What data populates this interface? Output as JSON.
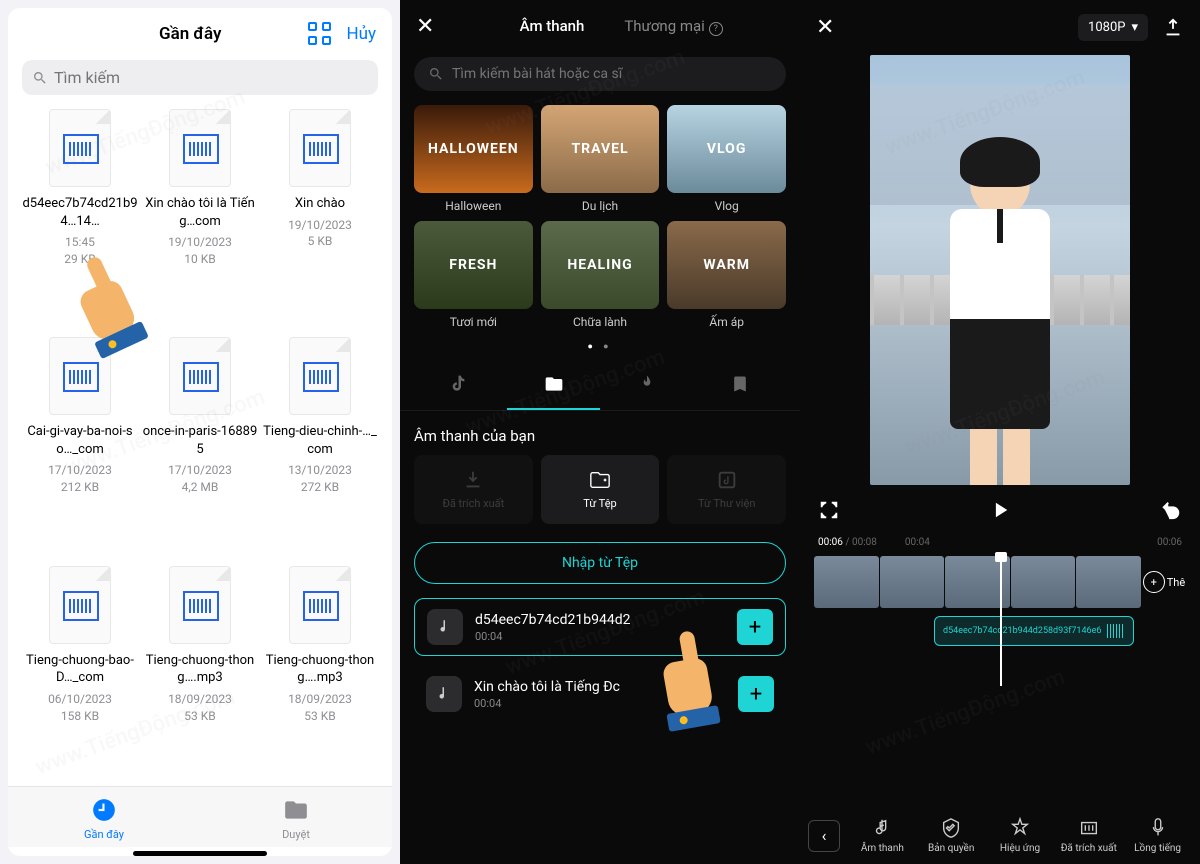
{
  "p1": {
    "title": "Gần đây",
    "cancel": "Hủy",
    "search_ph": "Tìm kiếm",
    "files": [
      {
        "name": "d54eec7b74cd21b94…14…",
        "date": "15:45",
        "size": "29 KB"
      },
      {
        "name": "Xin chào tôi là Tiếng…com",
        "date": "19/10/2023",
        "size": "10 KB"
      },
      {
        "name": "Xin chào",
        "date": "19/10/2023",
        "size": "5 KB"
      },
      {
        "name": "Cai-gi-vay-ba-noi-so…_com",
        "date": "17/10/2023",
        "size": "212 KB"
      },
      {
        "name": "once-in-paris-168895",
        "date": "17/10/2023",
        "size": "4,2 MB"
      },
      {
        "name": "Tieng-dieu-chinh-…_com",
        "date": "13/10/2023",
        "size": "272 KB"
      },
      {
        "name": "Tieng-chuong-bao-D…_com",
        "date": "06/10/2023",
        "size": "158 KB"
      },
      {
        "name": "Tieng-chuong-thong….mp3",
        "date": "18/09/2023",
        "size": "53 KB"
      },
      {
        "name": "Tieng-chuong-thong….mp3",
        "date": "18/09/2023",
        "size": "53 KB"
      }
    ],
    "tab_recent": "Gần đây",
    "tab_browse": "Duyệt"
  },
  "p2": {
    "tab_sound": "Âm thanh",
    "tab_commercial": "Thương mại",
    "search_ph": "Tìm kiếm bài hát hoặc ca sĩ",
    "cats": [
      {
        "overlay": "HALLOWEEN",
        "label": "Halloween",
        "cls": "c-hallo"
      },
      {
        "overlay": "TRAVEL",
        "label": "Du lịch",
        "cls": "c-travel"
      },
      {
        "overlay": "VLOG",
        "label": "Vlog",
        "cls": "c-vlog"
      },
      {
        "overlay": "FRESH",
        "label": "Tươi mới",
        "cls": "c-fresh"
      },
      {
        "overlay": "HEALING",
        "label": "Chữa lành",
        "cls": "c-heal"
      },
      {
        "overlay": "WARM",
        "label": "Ấm áp",
        "cls": "c-warm"
      }
    ],
    "section": "Âm thanh của bạn",
    "src_extracted": "Đã trích xuất",
    "src_file": "Từ Tệp",
    "src_library": "Từ Thư viện",
    "import_btn": "Nhập từ Tệp",
    "tracks": [
      {
        "name": "d54eec7b74cd21b944d2",
        "dur": "00:04",
        "sel": true
      },
      {
        "name": "Xin chào tôi là Tiếng Đc",
        "dur": "00:04",
        "sel": false
      }
    ]
  },
  "p3": {
    "resolution": "1080P",
    "time_cur": "00:06",
    "time_tot": "00:08",
    "ticks": [
      "00:04",
      "00:06"
    ],
    "audio_name": "d54eec7b74cd21b944d258d93f7146e6",
    "add_clip": "Thê",
    "tools": [
      "Âm thanh",
      "Bản quyền",
      "Hiệu ứng",
      "Đã trích xuất",
      "Lồng tiếng"
    ]
  },
  "watermark": "www.TiếngĐộng.com"
}
